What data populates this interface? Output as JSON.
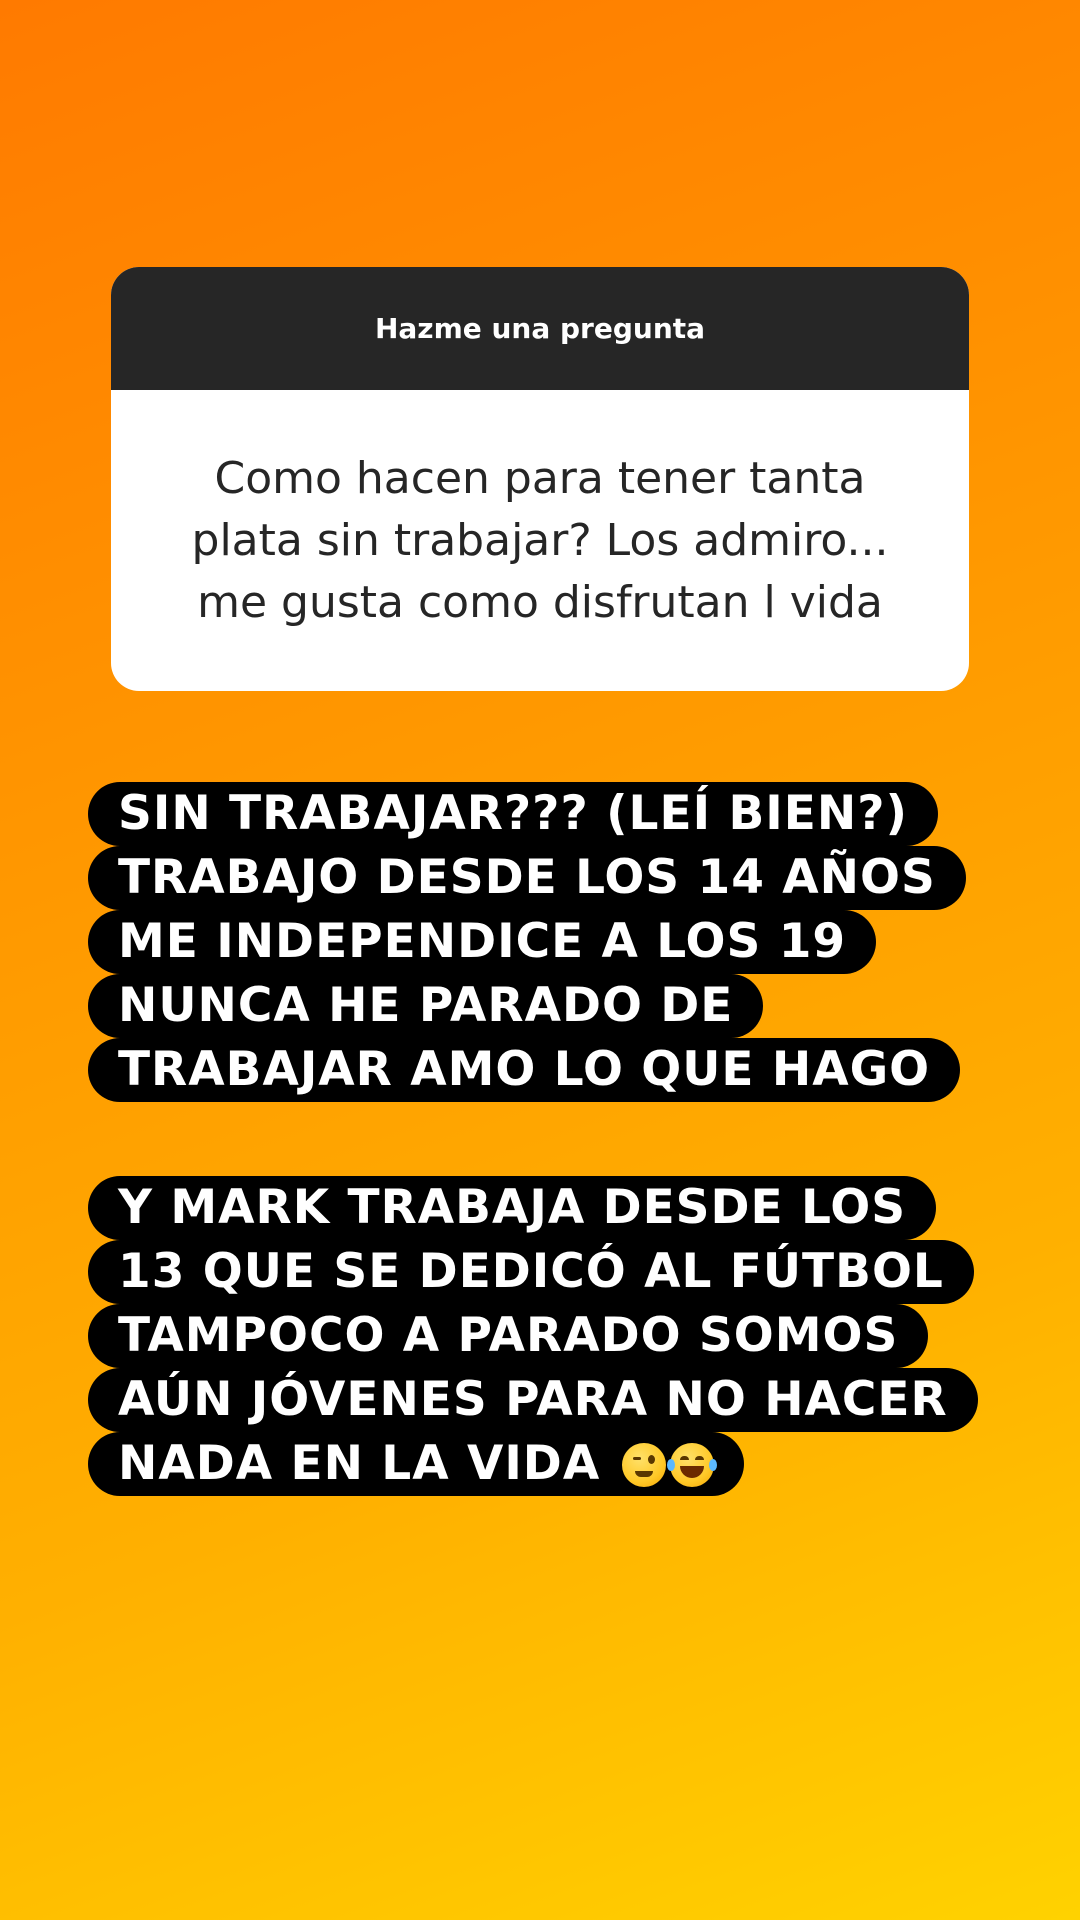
{
  "question_sticker": {
    "header": "Hazme una pregunta",
    "question": "Como hacen para tener tanta\nplata sin trabajar? Los admiro...\nme gusta como disfrutan l vida"
  },
  "answers": [
    {
      "lines": [
        "SIN TRABAJAR??? (LEÍ BIEN?)",
        "TRABAJO DESDE LOS 14 AÑOS",
        "ME INDEPENDICE A LOS 19",
        "NUNCA HE PARADO DE",
        "TRABAJAR AMO LO QUE HAGO"
      ]
    },
    {
      "lines": [
        "Y MARK TRABAJA DESDE LOS",
        "13 QUE SE DEDICÓ AL FÚTBOL",
        "TAMPOCO A PARADO SOMOS",
        "AÚN JÓVENES PARA NO HACER",
        "NADA  EN LA VIDA"
      ],
      "trailing_emojis": [
        "winking-face",
        "face-with-tears-of-joy"
      ]
    }
  ],
  "colors": {
    "gradient_start": "#ff7a00",
    "gradient_end": "#ffd200",
    "sticker_header": "#262626",
    "text_highlight": "#000000"
  }
}
